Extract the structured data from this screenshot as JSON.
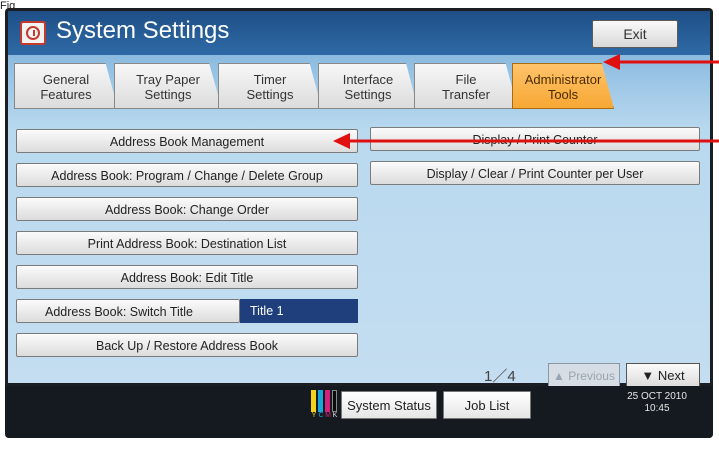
{
  "page_tag": "Fig",
  "title_bar": {
    "title": "System Settings",
    "exit_label": "Exit"
  },
  "tabs": [
    {
      "label_line1": "General",
      "label_line2": "Features",
      "active": false
    },
    {
      "label_line1": "Tray Paper",
      "label_line2": "Settings",
      "active": false
    },
    {
      "label_line1": "Timer",
      "label_line2": "Settings",
      "active": false
    },
    {
      "label_line1": "Interface",
      "label_line2": "Settings",
      "active": false
    },
    {
      "label_line1": "File",
      "label_line2": "Transfer",
      "active": false
    },
    {
      "label_line1": "Administrator",
      "label_line2": "Tools",
      "active": true
    }
  ],
  "left_buttons": [
    "Address Book Management",
    "Address Book: Program / Change / Delete Group",
    "Address Book: Change Order",
    "Print Address Book: Destination List",
    "Address Book: Edit Title",
    "Address Book: Switch Title",
    "Back Up / Restore Address Book"
  ],
  "switch_title_value": "Title 1",
  "right_buttons": [
    "Display / Print Counter",
    "Display / Clear / Print Counter per User"
  ],
  "pager": {
    "text": "1／4",
    "prev_label": "Previous",
    "next_label": "Next"
  },
  "taskbar": {
    "color_labels": [
      "Y",
      "C",
      "M",
      "K"
    ],
    "system_status_label": "System Status",
    "job_list_label": "Job List",
    "date": "25 OCT  2010",
    "time": "10:45"
  },
  "colors": {
    "title_bar": "#2f6aa6",
    "screen_bg": "#c4ddf0",
    "active_tab": "#f7a834",
    "selected_value": "#1e3f7c",
    "annotation_arrow": "#e01010"
  }
}
